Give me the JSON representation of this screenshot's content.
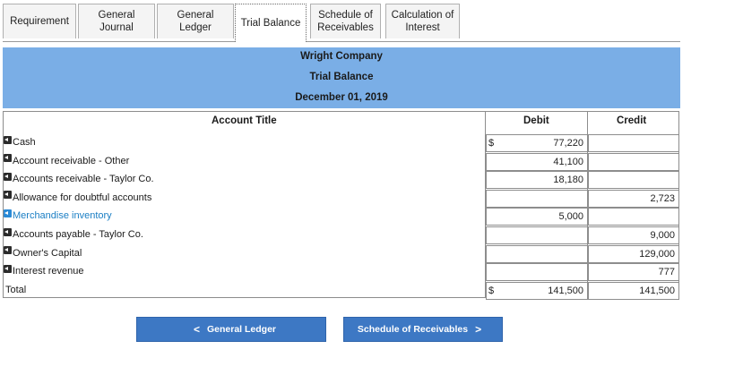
{
  "tabs": [
    {
      "label": "Requirement",
      "active": false
    },
    {
      "label": "General\nJournal",
      "active": false
    },
    {
      "label": "General\nLedger",
      "active": false
    },
    {
      "label": "Trial Balance",
      "active": true
    },
    {
      "label": "Schedule of\nReceivables",
      "active": false
    },
    {
      "label": "Calculation of\nInterest",
      "active": false
    }
  ],
  "header": {
    "company": "Wright Company",
    "report": "Trial Balance",
    "date": "December 01, 2019"
  },
  "table": {
    "columns": {
      "account": "Account Title",
      "debit": "Debit",
      "credit": "Credit"
    },
    "rows": [
      {
        "account": "Cash",
        "debit_currency": "$",
        "debit": "77,220",
        "credit": ""
      },
      {
        "account": "Account receivable - Other",
        "debit_currency": "",
        "debit": "41,100",
        "credit": ""
      },
      {
        "account": "Accounts receivable - Taylor Co.",
        "debit_currency": "",
        "debit": "18,180",
        "credit": ""
      },
      {
        "account": "Allowance for doubtful accounts",
        "debit_currency": "",
        "debit": "",
        "credit": "2,723"
      },
      {
        "account": "Merchandise inventory",
        "debit_currency": "",
        "debit": "5,000",
        "credit": "",
        "link": true
      },
      {
        "account": "Accounts payable - Taylor Co.",
        "debit_currency": "",
        "debit": "",
        "credit": "9,000"
      },
      {
        "account": "Owner's Capital",
        "debit_currency": "",
        "debit": "",
        "credit": "129,000"
      },
      {
        "account": "Interest revenue",
        "debit_currency": "",
        "debit": "",
        "credit": "777"
      }
    ],
    "total": {
      "label": "Total",
      "debit_currency": "$",
      "debit": "141,500",
      "credit_currency": "$",
      "credit": "141,500"
    }
  },
  "nav": {
    "prev_label": "General Ledger",
    "prev_chevron": "<",
    "next_label": "Schedule of Receivables",
    "next_chevron": ">"
  },
  "colors": {
    "band": "#7aaee6",
    "button": "#3d78c4",
    "link": "#1a7ec4"
  }
}
